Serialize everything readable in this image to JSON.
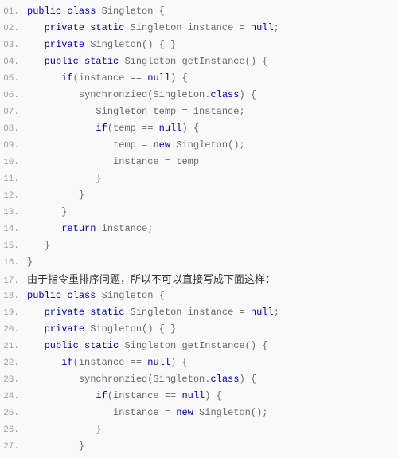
{
  "lines": [
    {
      "no": "01.",
      "indent": 0,
      "tokens": [
        [
          "kw",
          "public"
        ],
        [
          "",
          " "
        ],
        [
          "kw",
          "class"
        ],
        [
          "",
          " Singleton {"
        ]
      ]
    },
    {
      "no": "02.",
      "indent": 1,
      "tokens": [
        [
          "kw",
          "private"
        ],
        [
          "",
          " "
        ],
        [
          "kw",
          "static"
        ],
        [
          "",
          " Singleton instance = "
        ],
        [
          "kw",
          "null"
        ],
        [
          "",
          ";"
        ]
      ]
    },
    {
      "no": "03.",
      "indent": 1,
      "tokens": [
        [
          "kw",
          "private"
        ],
        [
          "",
          " Singleton() { }"
        ]
      ]
    },
    {
      "no": "04.",
      "indent": 1,
      "tokens": [
        [
          "kw",
          "public"
        ],
        [
          "",
          " "
        ],
        [
          "kw",
          "static"
        ],
        [
          "",
          " Singleton getInstance() {"
        ]
      ]
    },
    {
      "no": "05.",
      "indent": 2,
      "tokens": [
        [
          "kw",
          "if"
        ],
        [
          "",
          "(instance == "
        ],
        [
          "kw",
          "null"
        ],
        [
          "",
          ") {"
        ]
      ]
    },
    {
      "no": "06.",
      "indent": 3,
      "tokens": [
        [
          "",
          "synchronzied(Singleton."
        ],
        [
          "kw",
          "class"
        ],
        [
          "",
          ") {"
        ]
      ]
    },
    {
      "no": "07.",
      "indent": 4,
      "tokens": [
        [
          "",
          "Singleton temp = instance;"
        ]
      ]
    },
    {
      "no": "08.",
      "indent": 4,
      "tokens": [
        [
          "kw",
          "if"
        ],
        [
          "",
          "(temp == "
        ],
        [
          "kw",
          "null"
        ],
        [
          "",
          ") {"
        ]
      ]
    },
    {
      "no": "09.",
      "indent": 5,
      "tokens": [
        [
          "",
          "temp = "
        ],
        [
          "kw",
          "new"
        ],
        [
          "",
          " Singleton();"
        ]
      ]
    },
    {
      "no": "10.",
      "indent": 5,
      "tokens": [
        [
          "",
          "instance = temp"
        ]
      ]
    },
    {
      "no": "11.",
      "indent": 4,
      "tokens": [
        [
          "",
          "}"
        ]
      ]
    },
    {
      "no": "12.",
      "indent": 3,
      "tokens": [
        [
          "",
          "}"
        ]
      ]
    },
    {
      "no": "13.",
      "indent": 2,
      "tokens": [
        [
          "",
          "}"
        ]
      ]
    },
    {
      "no": "14.",
      "indent": 2,
      "tokens": [
        [
          "kw",
          "return"
        ],
        [
          "",
          " instance;"
        ]
      ]
    },
    {
      "no": "15.",
      "indent": 1,
      "tokens": [
        [
          "",
          "}"
        ]
      ]
    },
    {
      "no": "16.",
      "indent": 0,
      "tokens": [
        [
          "",
          "}"
        ]
      ]
    },
    {
      "no": "17.",
      "comment": "由于指令重排序问题，所以不可以直接写成下面这样："
    },
    {
      "no": "18.",
      "indent": 0,
      "tokens": [
        [
          "kw",
          "public"
        ],
        [
          "",
          " "
        ],
        [
          "kw",
          "class"
        ],
        [
          "",
          " Singleton {"
        ]
      ]
    },
    {
      "no": "19.",
      "indent": 1,
      "tokens": [
        [
          "kw",
          "private"
        ],
        [
          "",
          " "
        ],
        [
          "kw",
          "static"
        ],
        [
          "",
          " Singleton instance = "
        ],
        [
          "kw",
          "null"
        ],
        [
          "",
          ";"
        ]
      ]
    },
    {
      "no": "20.",
      "indent": 1,
      "tokens": [
        [
          "kw",
          "private"
        ],
        [
          "",
          " Singleton() { }"
        ]
      ]
    },
    {
      "no": "21.",
      "indent": 1,
      "tokens": [
        [
          "kw",
          "public"
        ],
        [
          "",
          " "
        ],
        [
          "kw",
          "static"
        ],
        [
          "",
          " Singleton getInstance() {"
        ]
      ]
    },
    {
      "no": "22.",
      "indent": 2,
      "tokens": [
        [
          "kw",
          "if"
        ],
        [
          "",
          "(instance == "
        ],
        [
          "kw",
          "null"
        ],
        [
          "",
          ") {"
        ]
      ]
    },
    {
      "no": "23.",
      "indent": 3,
      "tokens": [
        [
          "",
          "synchronzied(Singleton."
        ],
        [
          "kw",
          "class"
        ],
        [
          "",
          ") {"
        ]
      ]
    },
    {
      "no": "24.",
      "indent": 4,
      "tokens": [
        [
          "kw",
          "if"
        ],
        [
          "",
          "(instance == "
        ],
        [
          "kw",
          "null"
        ],
        [
          "",
          ") {"
        ]
      ]
    },
    {
      "no": "25.",
      "indent": 5,
      "tokens": [
        [
          "",
          "instance = "
        ],
        [
          "kw",
          "new"
        ],
        [
          "",
          " Singleton();"
        ]
      ]
    },
    {
      "no": "26.",
      "indent": 4,
      "tokens": [
        [
          "",
          "}"
        ]
      ]
    },
    {
      "no": "27.",
      "indent": 3,
      "tokens": [
        [
          "",
          "}"
        ]
      ]
    }
  ],
  "indent_unit": "   "
}
